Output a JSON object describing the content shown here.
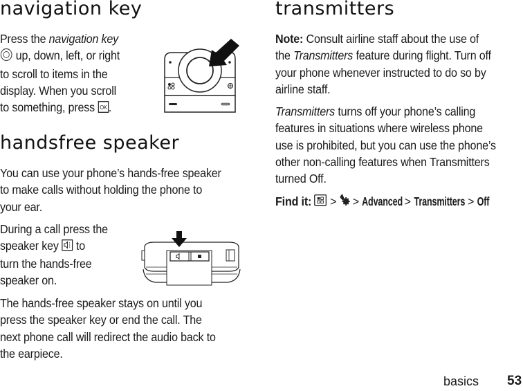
{
  "left": {
    "nav_section": {
      "heading": "navigation key",
      "para_pre": "Press the ",
      "para_italic": "navigation key",
      "line2": " up, down, left, or right",
      "line3": "to scroll to items in the",
      "line4": "display. When you scroll",
      "line5": "to something, press ",
      "line5_end": ".",
      "nav_icon": "navigation-key-icon",
      "ok_icon": "ok-key-icon"
    },
    "speaker_section": {
      "heading": "handsfree speaker",
      "para1_lines": [
        "You can use your phone’s hands-free speaker",
        "to make calls without holding the phone to",
        "your ear."
      ],
      "para2_line1": "During a call press the",
      "para2_line2_pre": "speaker key ",
      "para2_line2_post": " to",
      "para2_line3": "turn the hands-free",
      "para2_line4": "speaker on.",
      "speaker_icon": "speaker-key-icon",
      "para3_lines": [
        "The hands-free speaker stays on until you",
        "press the speaker key or end the call. The",
        "next phone call will redirect the audio back to",
        "the earpiece."
      ]
    }
  },
  "right": {
    "heading": "transmitters",
    "note_label": "Note:",
    "note_lines": [
      " Consult airline staff about the use of",
      "the ",
      " feature during flight. Turn off",
      "your phone whenever instructed to do so by",
      "airline staff."
    ],
    "note_italic": "Transmitters",
    "para_italic": "Transmitters",
    "para_lines": [
      " turns off your phone’s calling",
      "features in situations where wireless phone",
      "use is prohibited, but you can use the phone’s",
      "other non-calling features when Transmitters",
      "turned Off."
    ],
    "find_it": {
      "label": "Find it:",
      "sep": ">",
      "path": [
        "Advanced",
        "Transmitters",
        "Off"
      ],
      "icons": [
        "menu-key-icon",
        "settings-icon"
      ]
    }
  },
  "footer": {
    "section": "basics",
    "page_number": "53"
  }
}
